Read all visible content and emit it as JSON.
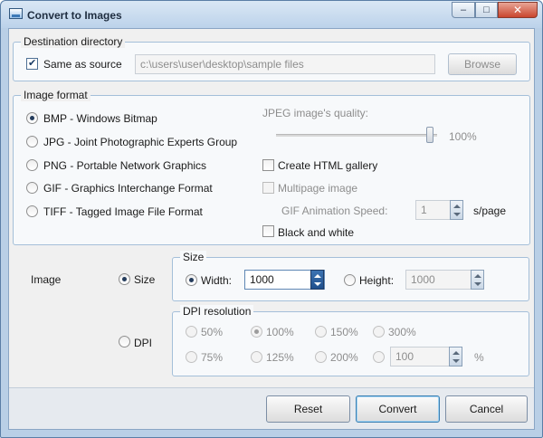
{
  "window": {
    "title": "Convert to Images",
    "min_glyph": "–",
    "max_glyph": "□",
    "close_glyph": "✕"
  },
  "destination": {
    "group_label": "Destination directory",
    "same_as_source_label": "Same as source",
    "same_as_source_checked": true,
    "path_value": "c:\\users\\user\\desktop\\sample files",
    "browse_label": "Browse"
  },
  "image_format": {
    "group_label": "Image format",
    "formats": [
      {
        "label": "BMP - Windows Bitmap",
        "selected": true
      },
      {
        "label": "JPG - Joint Photographic Experts Group",
        "selected": false
      },
      {
        "label": "PNG - Portable Network Graphics",
        "selected": false
      },
      {
        "label": "GIF - Graphics Interchange Format",
        "selected": false
      },
      {
        "label": "TIFF - Tagged Image File Format",
        "selected": false
      }
    ],
    "jpeg_quality_label": "JPEG image's quality:",
    "jpeg_quality_value": "100%",
    "jpeg_quality_fraction": 1.0,
    "html_gallery_label": "Create HTML gallery",
    "multipage_label": "Multipage image",
    "gif_speed_label": "GIF Animation Speed:",
    "gif_speed_value": "1",
    "gif_speed_unit": "s/page",
    "black_white_label": "Black and white"
  },
  "image_size": {
    "image_label": "Image",
    "size_option_label": "Size",
    "dpi_option_label": "DPI",
    "size_group_label": "Size",
    "width_label": "Width:",
    "width_value": "1000",
    "height_label": "Height:",
    "height_value": "1000",
    "dpi_group_label": "DPI resolution",
    "dpi_options": [
      "50%",
      "100%",
      "150%",
      "300%",
      "75%",
      "125%",
      "200%"
    ],
    "dpi_selected": "100%",
    "dpi_custom_value": "100",
    "dpi_custom_unit": "%"
  },
  "footer": {
    "reset_label": "Reset",
    "convert_label": "Convert",
    "cancel_label": "Cancel"
  }
}
